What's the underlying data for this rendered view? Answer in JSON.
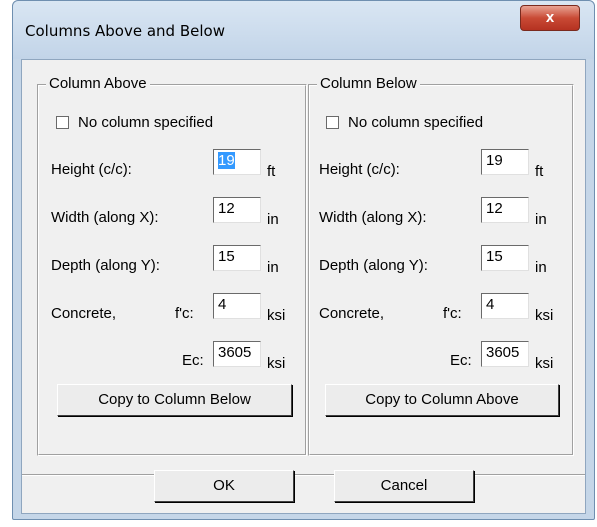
{
  "window": {
    "title": "Columns Above and Below",
    "close_glyph": "x"
  },
  "above": {
    "legend": "Column Above",
    "no_column_label": "No column specified",
    "height_label": "Height (c/c):",
    "height_value": "19",
    "height_unit": "ft",
    "width_label": "Width (along X):",
    "width_value": "12",
    "width_unit": "in",
    "depth_label": "Depth (along Y):",
    "depth_value": "15",
    "depth_unit": "in",
    "concrete_label": "Concrete,",
    "fc_label": "f'c:",
    "fc_value": "4",
    "fc_unit": "ksi",
    "ec_label": "Ec:",
    "ec_value": "3605",
    "ec_unit": "ksi",
    "copy_button": "Copy to Column Below"
  },
  "below": {
    "legend": "Column Below",
    "no_column_label": "No column specified",
    "height_label": "Height (c/c):",
    "height_value": "19",
    "height_unit": "ft",
    "width_label": "Width (along X):",
    "width_value": "12",
    "width_unit": "in",
    "depth_label": "Depth (along Y):",
    "depth_value": "15",
    "depth_unit": "in",
    "concrete_label": "Concrete,",
    "fc_label": "f'c:",
    "fc_value": "4",
    "fc_unit": "ksi",
    "ec_label": "Ec:",
    "ec_value": "3605",
    "ec_unit": "ksi",
    "copy_button": "Copy to Column Above"
  },
  "footer": {
    "ok_label": "OK",
    "cancel_label": "Cancel"
  }
}
